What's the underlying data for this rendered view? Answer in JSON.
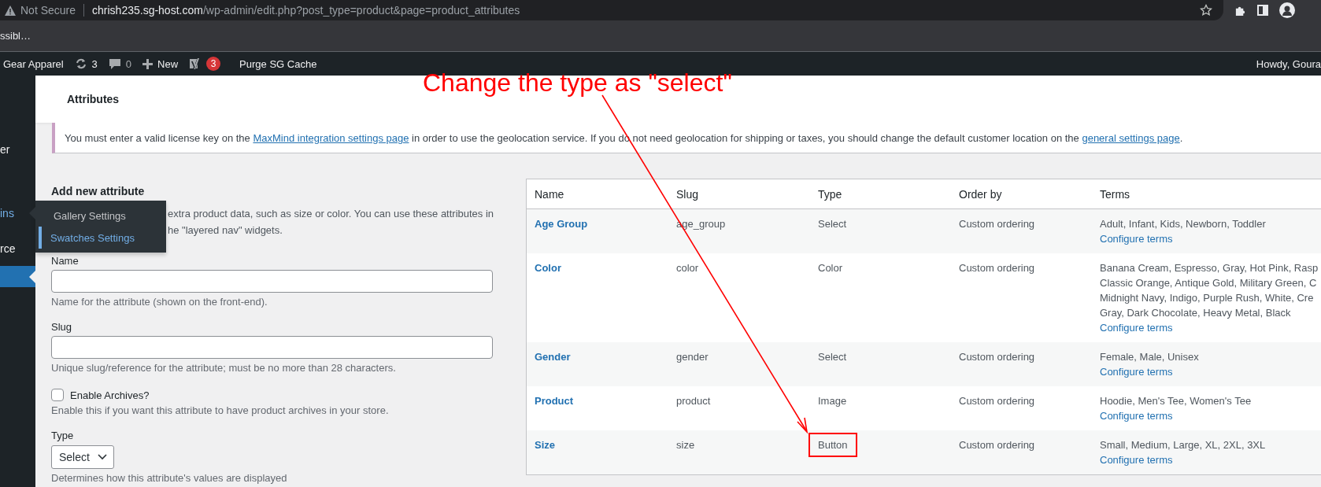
{
  "browser": {
    "security_label": "Not Secure",
    "url_host": "chrish235.sg-host.com",
    "url_path": "/wp-admin/edit.php?post_type=product&page=product_attributes",
    "bookmark": "ssibl…"
  },
  "admin_bar": {
    "site": "Gear Apparel",
    "updates": "3",
    "comments": "0",
    "new": "New",
    "seo_badge": "3",
    "purge": "Purge SG Cache",
    "greeting": "Howdy, Goura"
  },
  "sidebar": {
    "items": [
      {
        "label": "er",
        "selected": false
      },
      {
        "label": "ins",
        "selected": false,
        "submenu": [
          {
            "label": "Gallery Settings",
            "selected": false
          },
          {
            "label": "Swatches Settings",
            "selected": true
          }
        ]
      },
      {
        "label": "rce",
        "selected": false
      },
      {
        "selected": true
      }
    ]
  },
  "page_title": "Attributes",
  "notice": {
    "text_before": "You must enter a valid license key on the ",
    "link_1": "MaxMind integration settings page",
    "text_middle": " in order to use the geolocation service. If you do not need geolocation for shipping or taxes, you should change the default customer location on the ",
    "link_2": "general settings page",
    "text_after": "."
  },
  "form": {
    "heading": "Add new attribute",
    "description_lines": [
      "extra product data, such as size or color. You can use these attributes in",
      "he \"layered nav\" widgets."
    ],
    "fields": [
      {
        "kind": "text",
        "label": "Name",
        "hint": "Name for the attribute (shown on the front-end)."
      },
      {
        "kind": "text",
        "label": "Slug",
        "hint": "Unique slug/reference for the attribute; must be no more than 28 characters."
      },
      {
        "kind": "checkbox",
        "label": "Enable Archives?",
        "checked": false,
        "hint": "Enable this if you want this attribute to have product archives in your store."
      },
      {
        "kind": "select",
        "label": "Type",
        "value": "Select",
        "hint": "Determines how this attribute's values are displayed"
      }
    ]
  },
  "table": {
    "columns": [
      "Name",
      "Slug",
      "Type",
      "Order by",
      "Terms"
    ],
    "rows": [
      {
        "name": "Age Group",
        "slug": "age_group",
        "type": "Select",
        "order_by": "Custom ordering",
        "terms": [
          "Adult, Infant, Kids, Newborn, Toddler"
        ],
        "action": "Configure terms",
        "highlighted": false
      },
      {
        "name": "Color",
        "slug": "color",
        "type": "Color",
        "order_by": "Custom ordering",
        "terms": [
          "Banana Cream, Espresso, Gray, Hot Pink, Rasp",
          "Classic Orange, Antique Gold, Military Green, C",
          "Midnight Navy, Indigo, Purple Rush, White, Cre",
          "Gray, Dark Chocolate, Heavy Metal, Black"
        ],
        "action": "Configure terms",
        "highlighted": false
      },
      {
        "name": "Gender",
        "slug": "gender",
        "type": "Select",
        "order_by": "Custom ordering",
        "terms": [
          "Female, Male, Unisex"
        ],
        "action": "Configure terms",
        "highlighted": false
      },
      {
        "name": "Product",
        "slug": "product",
        "type": "Image",
        "order_by": "Custom ordering",
        "terms": [
          "Hoodie, Men's Tee, Women's Tee"
        ],
        "action": "Configure terms",
        "highlighted": false
      },
      {
        "name": "Size",
        "slug": "size",
        "type": "Button",
        "order_by": "Custom ordering",
        "terms": [
          "Small, Medium, Large, XL, 2XL, 3XL"
        ],
        "action": "Configure terms",
        "highlighted": true
      }
    ]
  },
  "annotation": {
    "text": "Change the type as \"select\""
  }
}
